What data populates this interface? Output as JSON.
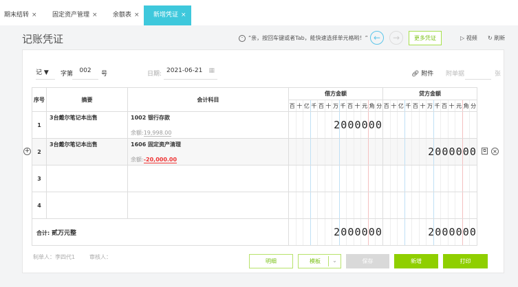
{
  "tabs": [
    {
      "label": "期末结转"
    },
    {
      "label": "固定资产管理"
    },
    {
      "label": "余额表"
    },
    {
      "label": "新增凭证",
      "active": true
    }
  ],
  "page_title": "记账凭证",
  "hint": "“亲，按回车键或者Tab，能快速选择单元格哟！”",
  "more_vouchers": "更多凭证",
  "video": "视频",
  "refresh": "刷新",
  "form": {
    "voucher_type": "记",
    "zi_di": "字第",
    "number": "002",
    "hao": "号",
    "date_label": "日期:",
    "date": "2021-06-21",
    "attachment": "附件",
    "attached_docs_label": "附单据",
    "attached_docs": "",
    "zhang": "张"
  },
  "table": {
    "headers": {
      "seq": "序号",
      "summary": "摘要",
      "account": "会计科目",
      "debit": "借方金额",
      "credit": "贷方金额"
    },
    "units": [
      "百",
      "十",
      "亿",
      "千",
      "百",
      "十",
      "万",
      "千",
      "百",
      "十",
      "元",
      "角",
      "分"
    ],
    "rows": [
      {
        "seq": "1",
        "summary": "3台戴尔笔记本出售",
        "account": "1002 银行存款",
        "balance_label": "余额:",
        "balance": "19,998.00",
        "debit": "2000000",
        "credit": ""
      },
      {
        "seq": "2",
        "summary": "3台戴尔笔记本出售",
        "account": "1606 固定资产清理",
        "balance_label": "余额:",
        "balance": "-20,000.00",
        "debit": "",
        "credit": "2000000"
      },
      {
        "seq": "3",
        "summary": "",
        "account": "",
        "debit": "",
        "credit": ""
      },
      {
        "seq": "4",
        "summary": "",
        "account": "",
        "debit": "",
        "credit": ""
      }
    ],
    "total_label": "合计:",
    "total_words": "贰万元整",
    "total_debit": "2000000",
    "total_credit": "2000000"
  },
  "footer": {
    "maker": "制单人：李四代1",
    "reviewer": "审核人：",
    "detail": "明细",
    "template": "模板",
    "save": "保存",
    "add": "新增",
    "print": "打印"
  }
}
